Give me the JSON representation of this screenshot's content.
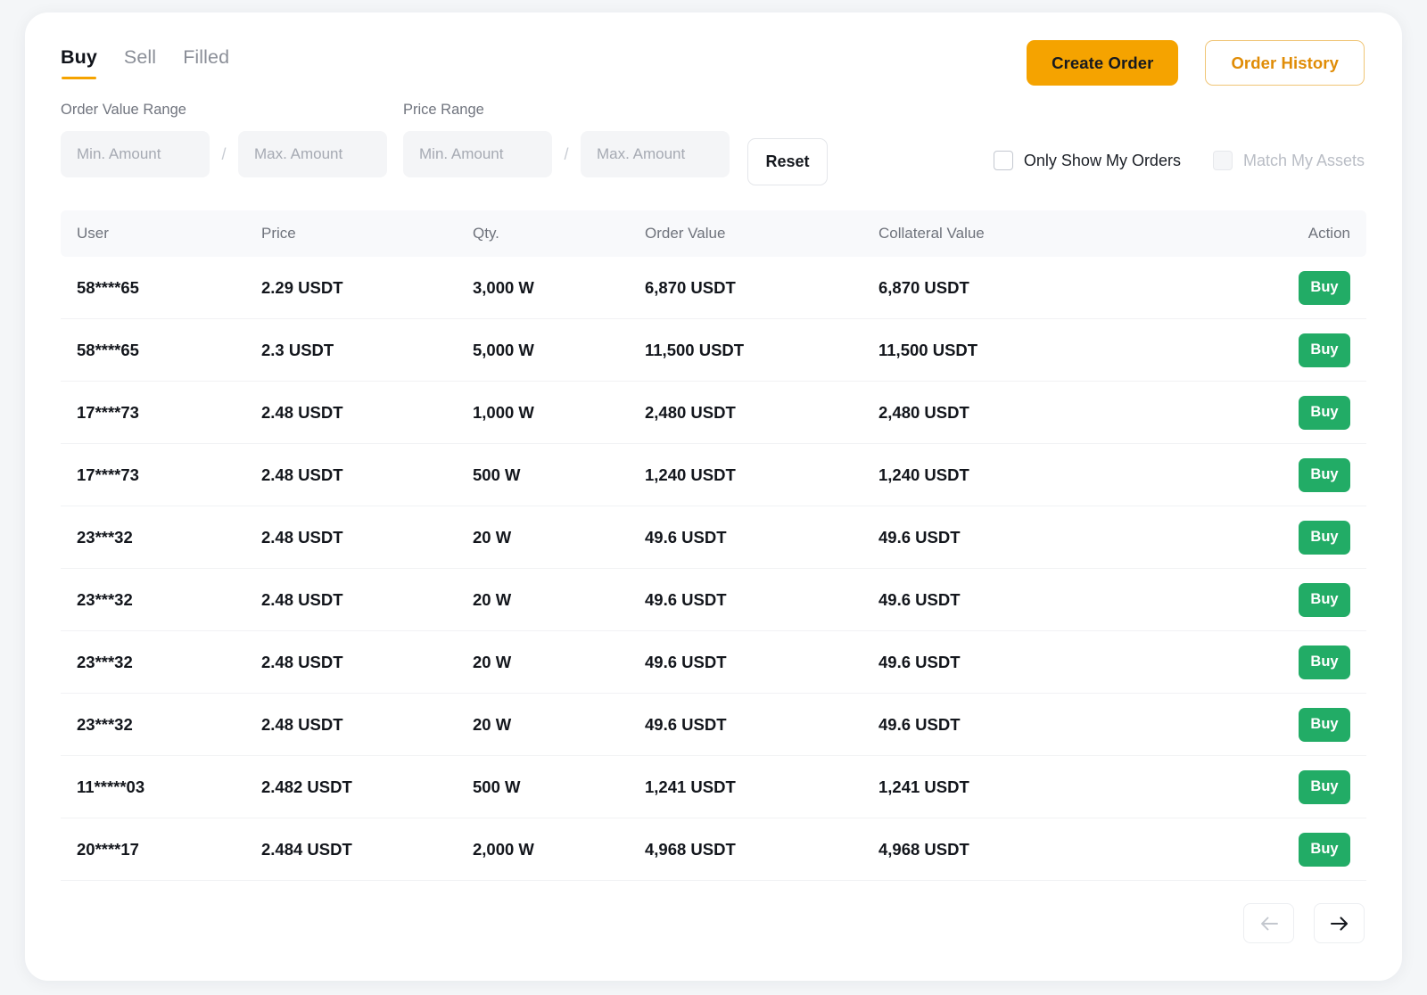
{
  "tabs": [
    {
      "label": "Buy",
      "active": true
    },
    {
      "label": "Sell",
      "active": false
    },
    {
      "label": "Filled",
      "active": false
    }
  ],
  "actions": {
    "create_order": "Create Order",
    "order_history": "Order History"
  },
  "filters": {
    "order_value_range_label": "Order Value Range",
    "price_range_label": "Price Range",
    "min_placeholder": "Min. Amount",
    "max_placeholder": "Max. Amount",
    "order_min_value": "",
    "order_max_value": "",
    "price_min_value": "",
    "price_max_value": "",
    "separator": "/",
    "reset_label": "Reset",
    "only_show_my_orders": "Only Show My Orders",
    "match_my_assets": "Match My Assets"
  },
  "table": {
    "columns": [
      "User",
      "Price",
      "Qty.",
      "Order Value",
      "Collateral Value",
      "Action"
    ],
    "action_label": "Buy",
    "rows": [
      {
        "user": "58****65",
        "price": "2.29 USDT",
        "qty": "3,000 W",
        "order_value": "6,870 USDT",
        "collateral_value": "6,870 USDT"
      },
      {
        "user": "58****65",
        "price": "2.3 USDT",
        "qty": "5,000 W",
        "order_value": "11,500 USDT",
        "collateral_value": "11,500 USDT"
      },
      {
        "user": "17****73",
        "price": "2.48 USDT",
        "qty": "1,000 W",
        "order_value": "2,480 USDT",
        "collateral_value": "2,480 USDT"
      },
      {
        "user": "17****73",
        "price": "2.48 USDT",
        "qty": "500 W",
        "order_value": "1,240 USDT",
        "collateral_value": "1,240 USDT"
      },
      {
        "user": "23***32",
        "price": "2.48 USDT",
        "qty": "20 W",
        "order_value": "49.6 USDT",
        "collateral_value": "49.6 USDT"
      },
      {
        "user": "23***32",
        "price": "2.48 USDT",
        "qty": "20 W",
        "order_value": "49.6 USDT",
        "collateral_value": "49.6 USDT"
      },
      {
        "user": "23***32",
        "price": "2.48 USDT",
        "qty": "20 W",
        "order_value": "49.6 USDT",
        "collateral_value": "49.6 USDT"
      },
      {
        "user": "23***32",
        "price": "2.48 USDT",
        "qty": "20 W",
        "order_value": "49.6 USDT",
        "collateral_value": "49.6 USDT"
      },
      {
        "user": "11*****03",
        "price": "2.482 USDT",
        "qty": "500 W",
        "order_value": "1,241 USDT",
        "collateral_value": "1,241 USDT"
      },
      {
        "user": "20****17",
        "price": "2.484 USDT",
        "qty": "2,000 W",
        "order_value": "4,968 USDT",
        "collateral_value": "4,968 USDT"
      }
    ]
  },
  "pagination": {
    "prev_icon": "arrow-left-icon",
    "next_icon": "arrow-right-icon",
    "prev_enabled": false,
    "next_enabled": true
  },
  "colors": {
    "accent_orange": "#f5a300",
    "buy_green": "#22ac66",
    "page_bg": "#f4f6f8",
    "card_bg": "#ffffff",
    "header_bg": "#f8f9fb"
  }
}
